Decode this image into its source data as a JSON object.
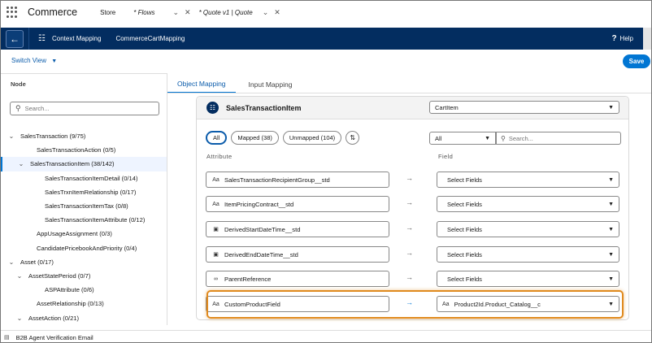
{
  "app": {
    "name": "Commerce"
  },
  "nav_tabs": [
    {
      "label": "Store"
    },
    {
      "label": "* Flows"
    },
    {
      "label": "* Quote v1 | Quote"
    }
  ],
  "toolbar": {
    "back_icon": "arrow-left-icon",
    "context_label": "Context Mapping",
    "mapping_name": "CommerceCartMapping",
    "help_label": "Help"
  },
  "switch_view": "Switch View",
  "save_label": "Save",
  "left_panel": {
    "header": "Node",
    "search_placeholder": "Search...",
    "tree": [
      {
        "label": "SalesTransaction (9/75)",
        "chev": "⌄"
      },
      {
        "label": "SalesTransactionAction (0/5)",
        "chev": ""
      },
      {
        "label": "SalesTransactionItem (38/142)",
        "chev": "⌄"
      },
      {
        "label": "SalesTransactionItemDetail (0/14)",
        "chev": ""
      },
      {
        "label": "SalesTrxnItemRelationship (0/17)",
        "chev": ""
      },
      {
        "label": "SalesTransactionItemTax (0/8)",
        "chev": ""
      },
      {
        "label": "SalesTransactionItemAttribute (0/12)",
        "chev": ""
      },
      {
        "label": "AppUsageAssignment (0/3)",
        "chev": ""
      },
      {
        "label": "CandidatePricebookAndPriority (0/4)",
        "chev": ""
      },
      {
        "label": "Asset (0/17)",
        "chev": "⌄"
      },
      {
        "label": "AssetStatePeriod (0/7)",
        "chev": "⌄"
      },
      {
        "label": "ASPAttribute (0/6)",
        "chev": ""
      },
      {
        "label": "AssetRelationship (0/13)",
        "chev": ""
      },
      {
        "label": "AssetAction (0/21)",
        "chev": "⌄"
      }
    ]
  },
  "right_panel": {
    "tabs": [
      {
        "label": "Object Mapping"
      },
      {
        "label": "Input Mapping"
      }
    ],
    "object_name": "SalesTransactionItem",
    "object_target": "CartItem",
    "filters": [
      {
        "label": "All"
      },
      {
        "label": "Mapped (38)"
      },
      {
        "label": "Unmapped (104)"
      }
    ],
    "filter_select": "All",
    "filter_search_placeholder": "Search...",
    "col_attribute": "Attribute",
    "col_field": "Field",
    "rows": [
      {
        "attr": "SalesTransactionRecipientGroup__std",
        "attr_icon": "Aa",
        "arrow": "→",
        "field": "Select Fields",
        "field_icon": ""
      },
      {
        "attr": "ItemPricingContract__std",
        "attr_icon": "Aa",
        "arrow": "→",
        "field": "Select Fields",
        "field_icon": ""
      },
      {
        "attr": "DerivedStartDateTime__std",
        "attr_icon": "▣",
        "arrow": "→",
        "field": "Select Fields",
        "field_icon": ""
      },
      {
        "attr": "DerivedEndDateTime__std",
        "attr_icon": "▣",
        "arrow": "→",
        "field": "Select Fields",
        "field_icon": ""
      },
      {
        "attr": "ParentReference",
        "attr_icon": "∞",
        "arrow": "→",
        "field": "Select Fields",
        "field_icon": ""
      },
      {
        "attr": "CustomProductField",
        "attr_icon": "Aa",
        "arrow": "→",
        "field": "Product2Id.Product_Catalog__c",
        "field_icon": "Aa"
      }
    ]
  },
  "bottom": {
    "label": "B2B Agent Verification Email"
  },
  "colors": {
    "navy": "#032d60",
    "accent": "#0176d3",
    "highlight": "#e08a1e"
  }
}
